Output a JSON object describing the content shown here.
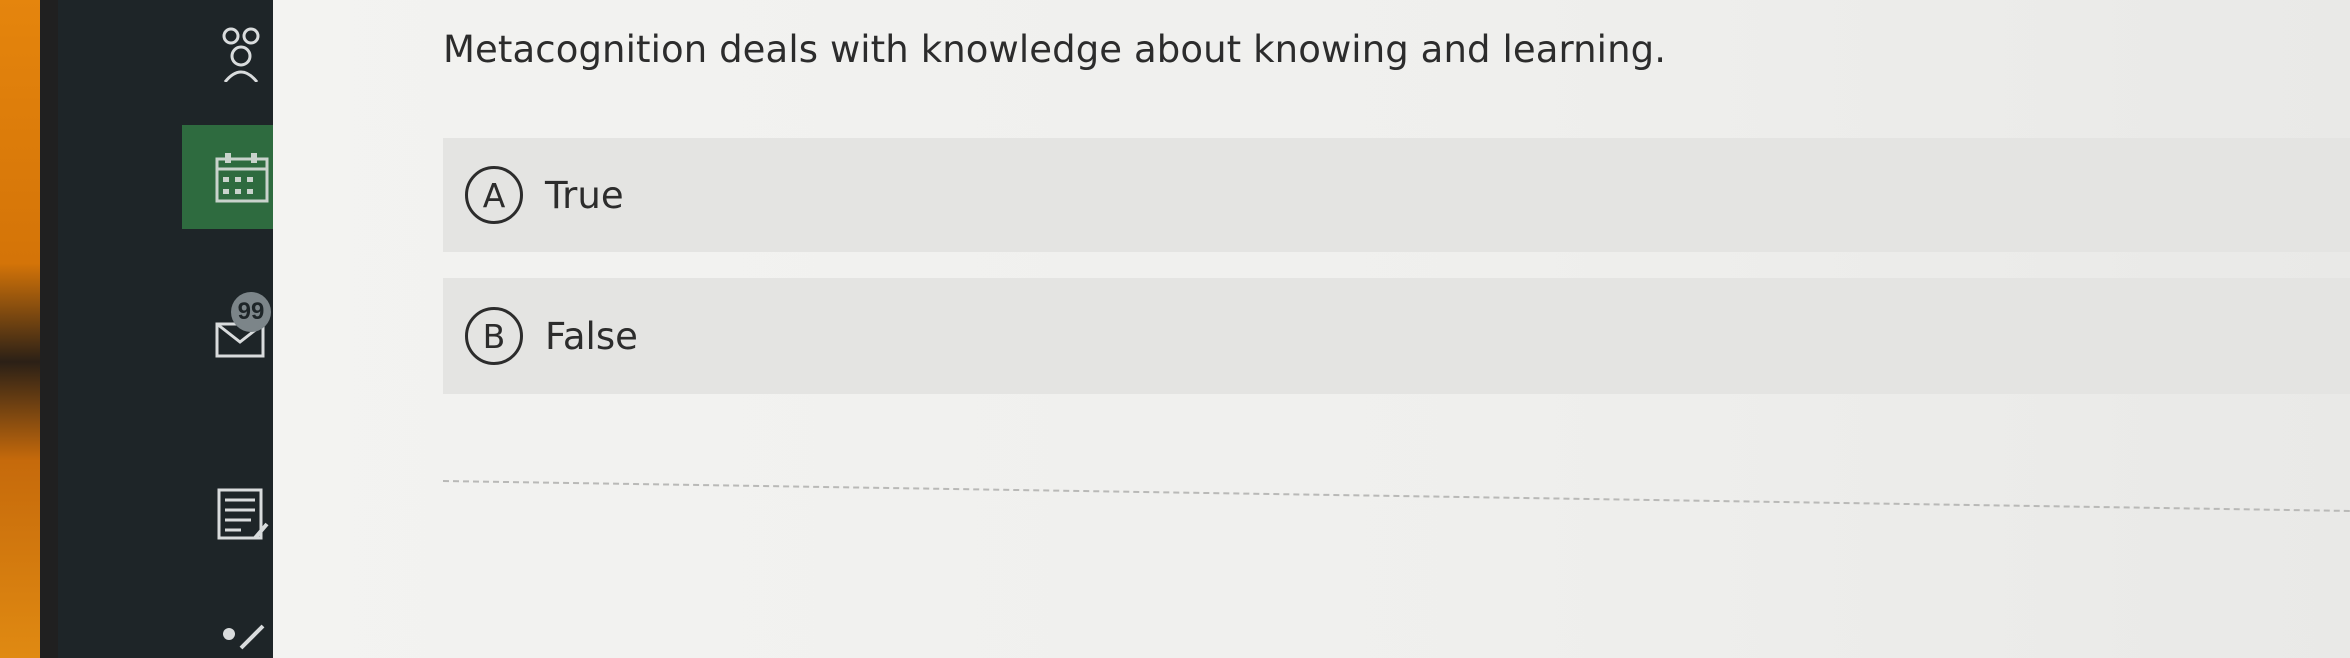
{
  "sidebar": {
    "items": [
      {
        "icon": "people-icon"
      },
      {
        "icon": "calendar-icon",
        "active": true
      },
      {
        "icon": "mail-icon",
        "badge": "99"
      },
      {
        "icon": "notes-icon"
      },
      {
        "icon": "settings-icon"
      }
    ],
    "active_color": "#2e6b3f",
    "background": "#1e2528"
  },
  "question": {
    "text": "Metacognition deals with knowledge about knowing and learning."
  },
  "options": [
    {
      "letter": "A",
      "label": "True"
    },
    {
      "letter": "B",
      "label": "False"
    }
  ]
}
